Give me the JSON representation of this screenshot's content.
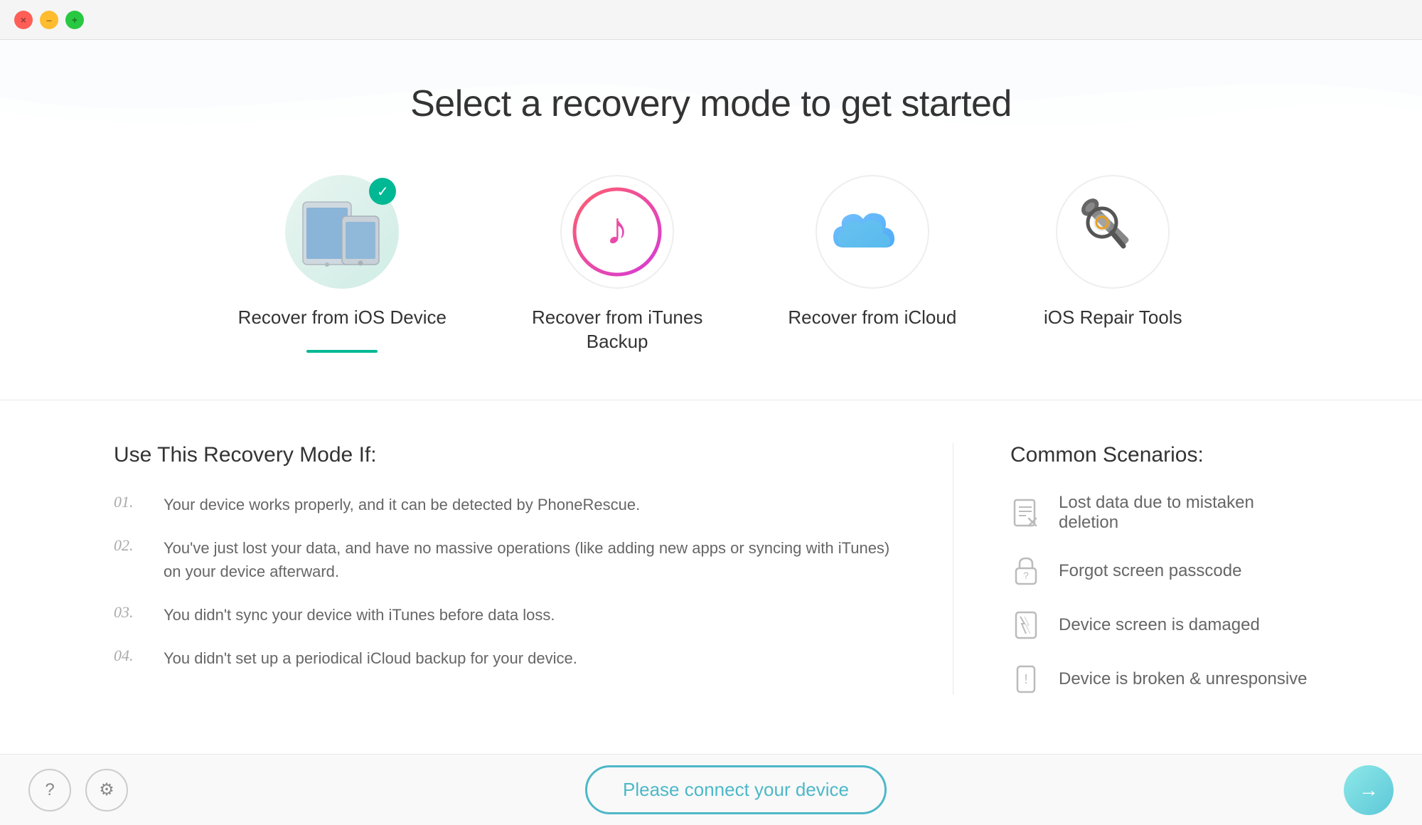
{
  "titlebar": {
    "close": "×",
    "minimize": "–",
    "maximize": "+"
  },
  "page": {
    "title": "Select a recovery mode to get started"
  },
  "modes": [
    {
      "id": "ios-device",
      "label": "Recover from iOS Device",
      "selected": true,
      "check": true
    },
    {
      "id": "itunes",
      "label": "Recover from iTunes\nBackup",
      "selected": false,
      "check": false
    },
    {
      "id": "icloud",
      "label": "Recover from iCloud",
      "selected": false,
      "check": false
    },
    {
      "id": "repair",
      "label": "iOS Repair Tools",
      "selected": false,
      "check": false
    }
  ],
  "use_if": {
    "heading": "Use This Recovery Mode If:",
    "items": [
      {
        "number": "01.",
        "text": "Your device works properly, and it can be detected by PhoneRescue."
      },
      {
        "number": "02.",
        "text": "You've just lost your data, and have no massive operations (like adding new apps or syncing with iTunes) on your device afterward."
      },
      {
        "number": "03.",
        "text": "You didn't sync your device with iTunes before data loss."
      },
      {
        "number": "04.",
        "text": "You didn't set up a periodical iCloud backup for your device."
      }
    ]
  },
  "scenarios": {
    "heading": "Common Scenarios:",
    "items": [
      "Lost data due to mistaken deletion",
      "Forgot screen passcode",
      "Device screen is damaged",
      "Device is broken & unresponsive"
    ]
  },
  "bottom": {
    "connect_label": "Please connect your device",
    "next_arrow": "→"
  }
}
